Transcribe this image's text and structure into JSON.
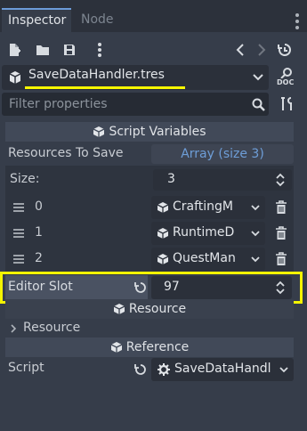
{
  "tabs": [
    {
      "label": "Inspector"
    },
    {
      "label": "Node"
    }
  ],
  "resource": {
    "name": "SaveDataHandler.tres"
  },
  "filter": {
    "placeholder": "Filter properties"
  },
  "sections": {
    "script_variables": "Script Variables",
    "resource": "Resource",
    "reference": "Reference"
  },
  "properties": {
    "resources_to_save": {
      "label": "Resources To Save",
      "value": "Array (size 3)"
    },
    "size": {
      "label": "Size:",
      "value": "3"
    },
    "array_items": [
      {
        "index": "0",
        "value": "CraftingM"
      },
      {
        "index": "1",
        "value": "RuntimeD"
      },
      {
        "index": "2",
        "value": "QuestMan"
      }
    ],
    "editor_slot": {
      "label": "Editor Slot",
      "value": "97"
    },
    "resource_group": {
      "label": "Resource"
    },
    "script": {
      "label": "Script",
      "value": "SaveDataHandl"
    }
  },
  "icons": {
    "doc_label": "DOC"
  },
  "colors": {
    "accent": "#6e9ed8",
    "highlight": "#f4f400",
    "background": "#363d4a"
  }
}
